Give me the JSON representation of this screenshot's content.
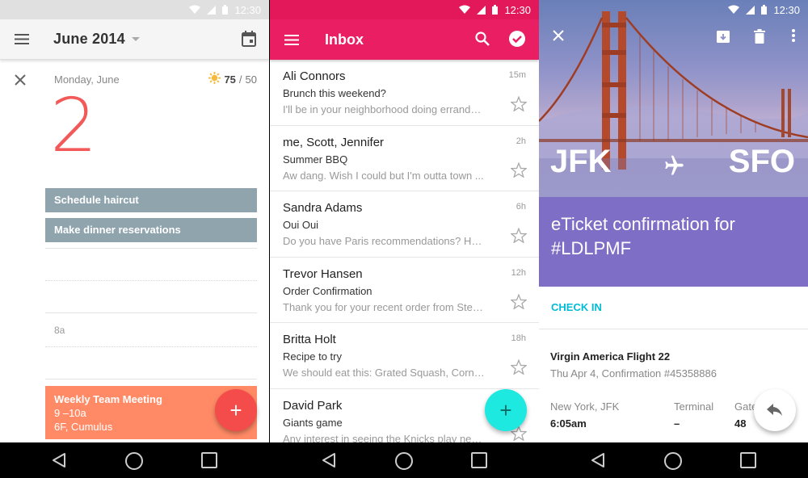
{
  "status_bar": {
    "time": "12:30"
  },
  "calendar": {
    "month": "June 2014",
    "day_label": "Monday, June",
    "weather": {
      "high": "75",
      "separator": "/",
      "low": "50"
    },
    "date_number": "2",
    "tasks": [
      "Schedule haircut",
      "Make dinner reservations"
    ],
    "time_marker": "8a",
    "event": {
      "title": "Weekly Team Meeting",
      "time": "9 –10a",
      "location": "6F, Cumulus"
    },
    "fab_label": "+",
    "colors": {
      "date": "#f25a5a",
      "task": "#90a4ae",
      "event": "#ff8a65",
      "fab": "#f44b4b"
    }
  },
  "inbox": {
    "title": "Inbox",
    "accent": "#e91e63",
    "fab_label": "+",
    "emails": [
      {
        "sender": "Ali Connors",
        "subject": "Brunch this weekend?",
        "preview": "I'll be in your neighborhood doing errands ...",
        "time": "15m"
      },
      {
        "sender": "me, Scott, Jennifer",
        "subject": "Summer BBQ",
        "preview": "Aw dang. Wish I could but I'm outta town ...",
        "time": "2h"
      },
      {
        "sender": "Sandra Adams",
        "subject": "Oui Oui",
        "preview": "Do you have Paris recommendations? Hav...",
        "time": "6h"
      },
      {
        "sender": "Trevor Hansen",
        "subject": "Order Confirmation",
        "preview": "Thank you for your recent order from Stev...",
        "time": "12h"
      },
      {
        "sender": "Britta Holt",
        "subject": "Recipe to try",
        "preview": "We should eat this: Grated Squash, Corn, ...",
        "time": "18h"
      },
      {
        "sender": "David Park",
        "subject": "Giants game",
        "preview": "Any interest in seeing the Knicks play next ...",
        "time": ""
      }
    ]
  },
  "ticket": {
    "from": "JFK",
    "to": "SFO",
    "title": "eTicket confirmation for #LDLPMF",
    "check_in": "CHECK IN",
    "flight": "Virgin America Flight 22",
    "confirmation": "Thu Apr 4, Confirmation #45358886",
    "origin_label": "New York, JFK",
    "origin_time": "6:05am",
    "terminal_label": "Terminal",
    "terminal_value": "–",
    "gate_label": "Gate",
    "gate_value": "48",
    "colors": {
      "band": "#7e6ec6",
      "link": "#00bcd4"
    }
  }
}
